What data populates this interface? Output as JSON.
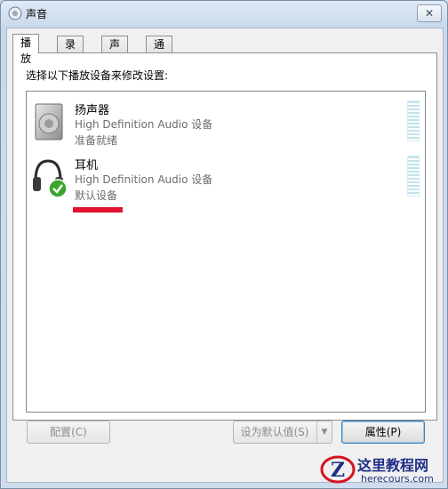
{
  "window": {
    "title": "声音",
    "close_glyph": "✕"
  },
  "tabs": [
    {
      "label": "播放",
      "active": true
    },
    {
      "label": "录制",
      "active": false
    },
    {
      "label": "声音",
      "active": false
    },
    {
      "label": "通信",
      "active": false
    }
  ],
  "panel": {
    "instruction": "选择以下播放设备来修改设置:",
    "devices": [
      {
        "name": "扬声器",
        "description": "High Definition Audio 设备",
        "status": "准备就绪",
        "icon": "speaker-icon"
      },
      {
        "name": "耳机",
        "description": "High Definition Audio 设备",
        "status": "默认设备",
        "icon": "headphones-icon",
        "default_badge": "green-check-icon"
      }
    ]
  },
  "buttons": {
    "configure": "配置(C)",
    "set_default": "设为默认值(S)",
    "properties": "属性(P)"
  },
  "watermark": {
    "line1": "这里教程网",
    "line2": "herecours.com",
    "logo_letter": "Z"
  },
  "colors": {
    "highlight_red": "#e0142e",
    "check_green": "#3aa42c",
    "watermark_blue": "#1f2f86"
  }
}
